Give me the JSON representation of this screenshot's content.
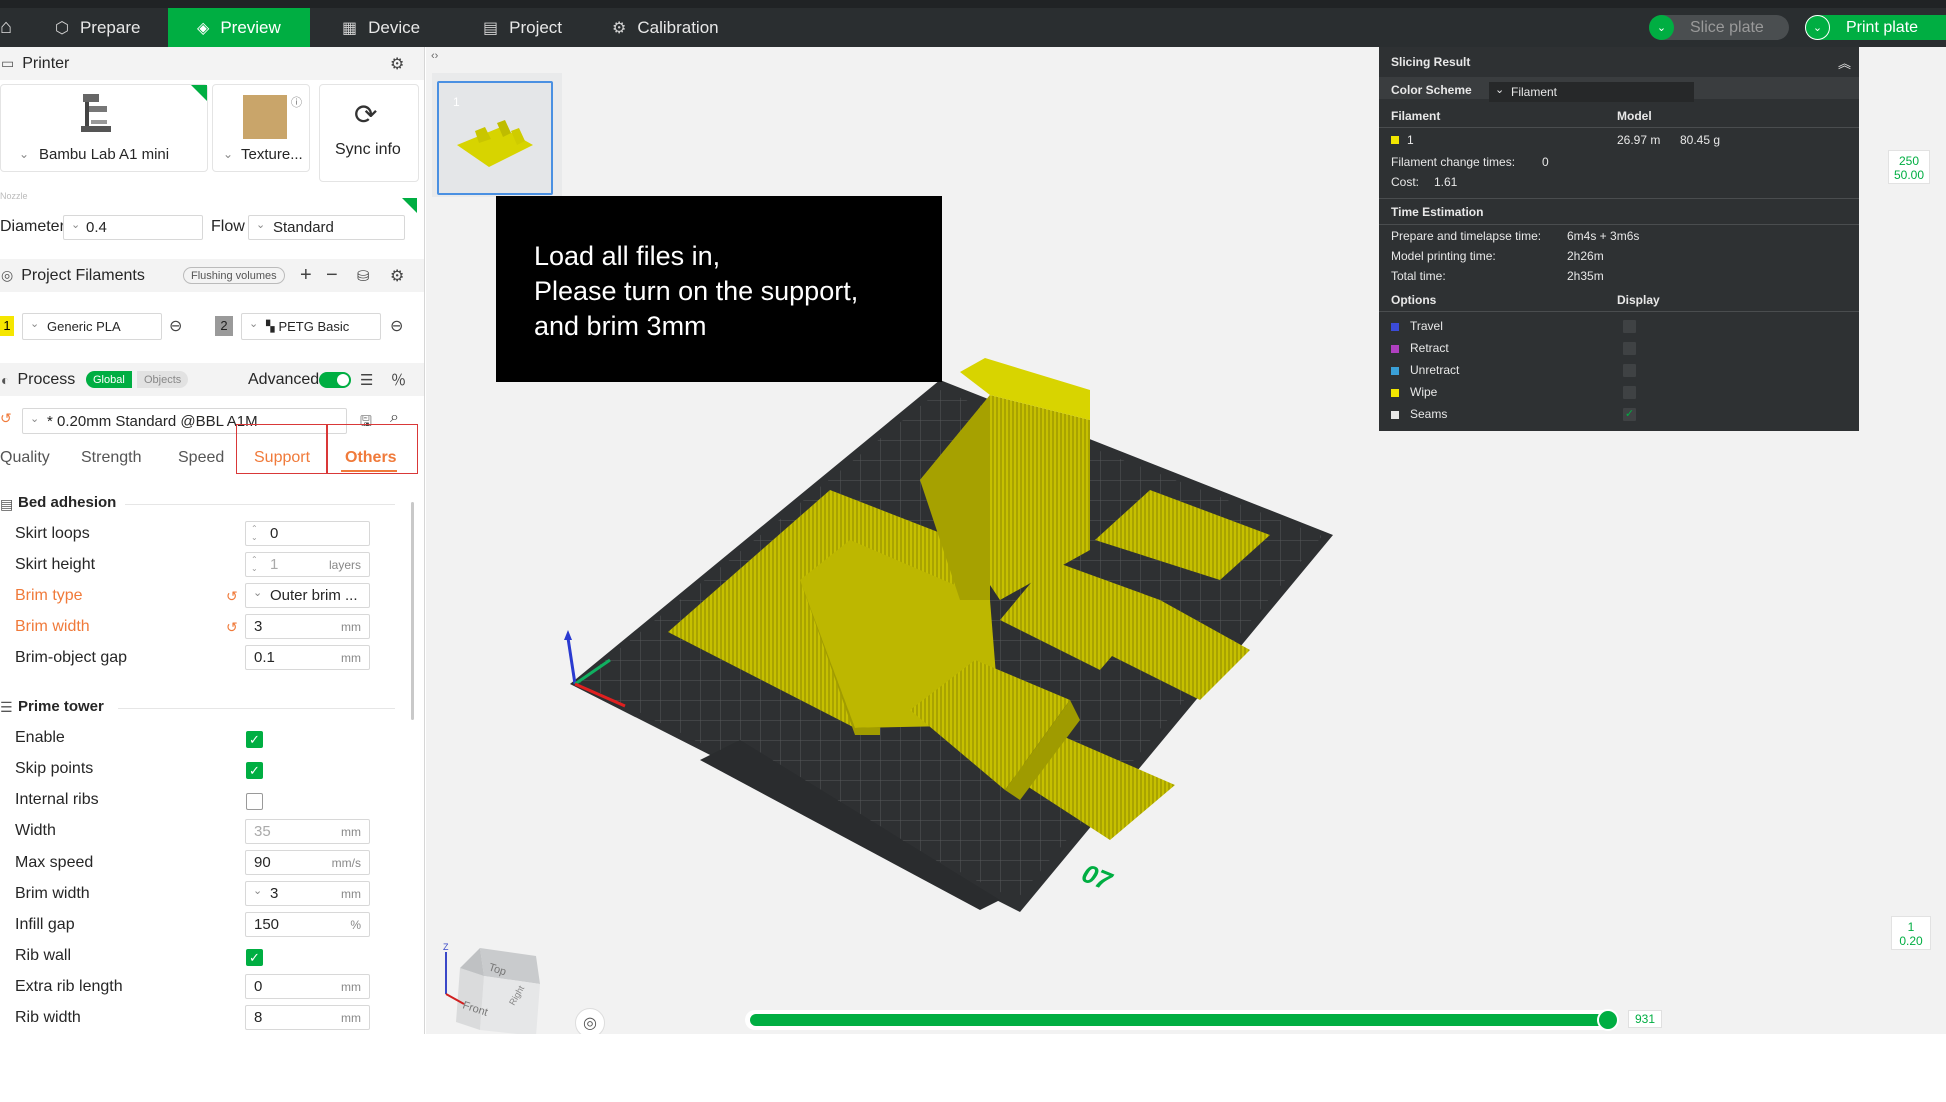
{
  "topbar": {
    "tabs": [
      {
        "label": "Prepare",
        "icon": "prepare-icon"
      },
      {
        "label": "Preview",
        "icon": "preview-icon"
      },
      {
        "label": "Device",
        "icon": "device-icon"
      },
      {
        "label": "Project",
        "icon": "project-icon"
      },
      {
        "label": "Calibration",
        "icon": "calibration-icon"
      }
    ],
    "active_tab": "Preview",
    "slice_label": "Slice plate",
    "print_label": "Print plate"
  },
  "printer": {
    "section_title": "Printer",
    "printer_name": "Bambu Lab A1 mini",
    "plate_name": "Texture...",
    "sync_label": "Sync info",
    "nozzle_caption": "Nozzle",
    "diameter_label": "Diameter",
    "diameter_value": "0.4",
    "flow_label": "Flow",
    "flow_value": "Standard"
  },
  "filaments": {
    "section_title": "Project Filaments",
    "flushing_label": "Flushing volumes",
    "items": [
      {
        "index": "1",
        "name": "Generic PLA",
        "color": "#f5e600"
      },
      {
        "index": "2",
        "name": "PETG Basic",
        "color": "#9a9a9a"
      }
    ]
  },
  "process": {
    "section_title": "Process",
    "scope_global": "Global",
    "scope_objects": "Objects",
    "advanced_label": "Advanced",
    "preset": "* 0.20mm Standard @BBL A1M",
    "tabs": [
      "Quality",
      "Strength",
      "Speed",
      "Support",
      "Others"
    ],
    "active_tab": "Others",
    "highlighted_tabs": [
      "Support",
      "Others"
    ]
  },
  "bed_adhesion": {
    "title": "Bed adhesion",
    "skirt_loops_label": "Skirt loops",
    "skirt_loops_value": "0",
    "skirt_height_label": "Skirt height",
    "skirt_height_value": "1",
    "skirt_height_unit": "layers",
    "brim_type_label": "Brim type",
    "brim_type_value": "Outer brim ...",
    "brim_width_label": "Brim width",
    "brim_width_value": "3",
    "brim_width_unit": "mm",
    "brim_gap_label": "Brim-object gap",
    "brim_gap_value": "0.1",
    "brim_gap_unit": "mm"
  },
  "prime_tower": {
    "title": "Prime tower",
    "enable_label": "Enable",
    "enable_checked": true,
    "skip_points_label": "Skip points",
    "skip_points_checked": true,
    "internal_ribs_label": "Internal ribs",
    "internal_ribs_checked": false,
    "width_label": "Width",
    "width_value": "35",
    "width_unit": "mm",
    "max_speed_label": "Max speed",
    "max_speed_value": "90",
    "max_speed_unit": "mm/s",
    "brim_width_label": "Brim width",
    "brim_width_value": "3",
    "brim_width_unit": "mm",
    "infill_gap_label": "Infill gap",
    "infill_gap_value": "150",
    "infill_gap_unit": "%",
    "rib_wall_label": "Rib wall",
    "rib_wall_checked": true,
    "extra_rib_label": "Extra rib length",
    "extra_rib_value": "0",
    "extra_rib_unit": "mm",
    "rib_width_label": "Rib width",
    "rib_width_value": "8",
    "rib_width_unit": "mm"
  },
  "plate": {
    "thumb_index": "1",
    "plate_number": "07"
  },
  "tooltip": {
    "line1": "Load all files in,",
    "line2": "Please turn on the support,",
    "line3": "and brim 3mm"
  },
  "slicing_result": {
    "title": "Slicing Result",
    "color_scheme_label": "Color Scheme",
    "color_scheme_value": "Filament",
    "filament_header": "Filament",
    "model_header": "Model",
    "filament_index": "1",
    "filament_length": "26.97 m",
    "filament_weight": "80.45 g",
    "change_times_label": "Filament change times:",
    "change_times_value": "0",
    "cost_label": "Cost:",
    "cost_value": "1.61",
    "time_title": "Time Estimation",
    "prepare_label": "Prepare and timelapse time:",
    "prepare_value": "6m4s + 3m6s",
    "model_time_label": "Model printing time:",
    "model_time_value": "2h26m",
    "total_label": "Total time:",
    "total_value": "2h35m",
    "options_header": "Options",
    "display_header": "Display",
    "options": [
      {
        "label": "Travel",
        "color": "#3b4bd8",
        "checked": false
      },
      {
        "label": "Retract",
        "color": "#b040c0",
        "checked": false
      },
      {
        "label": "Unretract",
        "color": "#3aa0d8",
        "checked": false
      },
      {
        "label": "Wipe",
        "color": "#f2e600",
        "checked": false
      },
      {
        "label": "Seams",
        "color": "#e8e8e8",
        "checked": true
      }
    ]
  },
  "layer_ruler": {
    "top_layer": "250",
    "top_height": "50.00",
    "bottom_layer": "1",
    "bottom_height": "0.20"
  },
  "move_slider": {
    "value": "931",
    "fraction": 1.0
  },
  "view_cube": {
    "top": "Top",
    "front": "Front",
    "right": "Right"
  }
}
